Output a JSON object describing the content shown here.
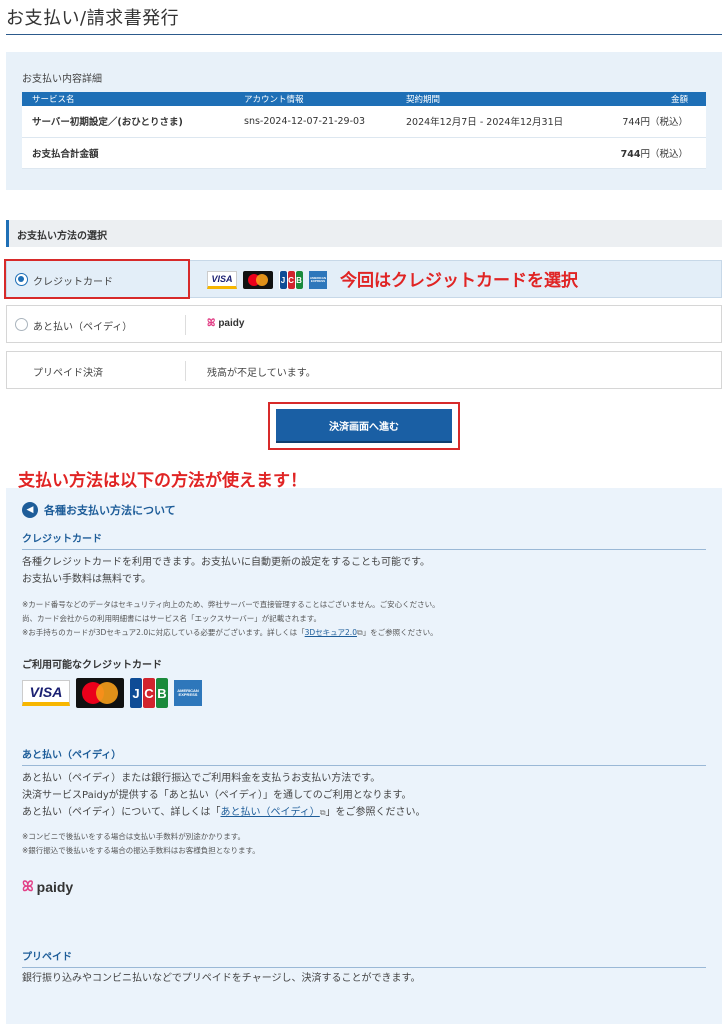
{
  "page": {
    "title": "お支払い/請求書発行"
  },
  "detail": {
    "heading": "お支払い内容詳細",
    "columns": [
      "サービス名",
      "アカウント情報",
      "契約期間",
      "金額"
    ],
    "row": {
      "service": "サーバー初期設定／(おひとりさま)",
      "account": "sns-2024-12-07-21-29-03",
      "period": "2024年12月7日 - 2024年12月31日",
      "amount": "744円（税込）"
    },
    "total": {
      "label": "お支払合計金額",
      "amount": "744",
      "suffix": "円（税込）"
    }
  },
  "methods": {
    "heading": "お支払い方法の選択",
    "credit": {
      "label": "クレジットカード",
      "selected": true
    },
    "paidy": {
      "label": "あと払い（ペイディ）",
      "logo_text": "paidy"
    },
    "prepaid": {
      "label": "プリペイド決済",
      "desc": "残高が不足しています。"
    }
  },
  "card_brands": {
    "visa": "VISA",
    "jcb": [
      "J",
      "C",
      "B"
    ],
    "amex_top": "AMERICAN",
    "amex_bottom": "EXPRESS"
  },
  "annotations": {
    "credit_note": "今回はクレジットカードを選択",
    "methods_note": "支払い方法は以下の方法が使えます！"
  },
  "proceed_button": {
    "label": "決済画面へ進む"
  },
  "info": {
    "title": "各種お支払い方法について",
    "credit": {
      "title": "クレジットカード",
      "line1": "各種クレジットカードを利用できます。お支払いに自動更新の設定をすることも可能です。",
      "line2": "お支払い手数料は無料です。",
      "note1": "※カード番号などのデータはセキュリティ向上のため、弊社サーバーで直接管理することはございません。ご安心ください。",
      "note2": "尚、カード会社からの利用明細書にはサービス名「エックスサーバー」が記載されます。",
      "note3_pre": "※お手持ちのカードが3Dセキュア2.0に対応している必要がございます。詳しくは「",
      "note3_link": "3Dセキュア2.0",
      "note3_post": "」をご参照ください。",
      "available_heading": "ご利用可能なクレジットカード"
    },
    "paidy": {
      "title": "あと払い（ペイディ）",
      "line1": "あと払い（ペイディ）または銀行振込でご利用料金を支払うお支払い方法です。",
      "line2": "決済サービスPaidyが提供する「あと払い（ペイディ）」を通してのご利用となります。",
      "line3_pre": "あと払い（ペイディ）について、詳しくは「",
      "line3_link": "あと払い（ペイディ）",
      "line3_post": "」をご参照ください。",
      "note1": "※コンビニで後払いをする場合は支払い手数料が別途かかります。",
      "note2": "※銀行振込で後払いをする場合の振込手数料はお客様負担となります。",
      "logo_text": "paidy"
    },
    "prepaid": {
      "title": "プリペイド",
      "line1": "銀行振り込みやコンビニ払いなどでプリペイドをチャージし、決済することができます。"
    }
  }
}
